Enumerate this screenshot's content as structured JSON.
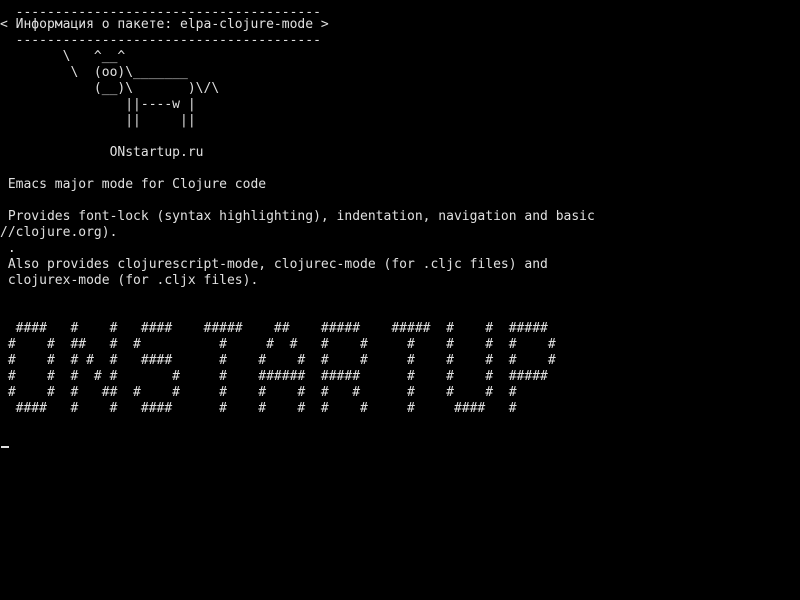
{
  "terminal": {
    "text_color": "#e0e0e0",
    "background_color": "#000000",
    "cowsay": {
      "top_border": "  ---------------------------------------",
      "message": "< Информация о пакете: elpa-clojure-mode >",
      "bottom_border": "  ---------------------------------------",
      "cow": [
        "        \\   ^__^",
        "         \\  (oo)\\_______",
        "            (__)\\       )\\/\\",
        "                ||----w |",
        "                ||     ||"
      ]
    },
    "site": "              ONstartup.ru",
    "description": {
      "summary": " Emacs major mode for Clojure code",
      "details": [
        " Provides font-lock (syntax highlighting), indentation, navigation and basic",
        "//clojure.org).",
        " .",
        " Also provides clojurescript-mode, clojurec-mode (for .cljc files) and",
        " clojurex-mode (for .cljx files)."
      ]
    },
    "banner": [
      "  ####   #    #   ####    #####    ##    #####    #####  #    #  #####",
      " #    #  ##   #  #          #     #  #   #    #     #    #    #  #    #",
      " #    #  # #  #   ####      #    #    #  #    #     #    #    #  #    #",
      " #    #  #  # #       #     #    ######  #####      #    #    #  #####",
      " #    #  #   ##  #    #     #    #    #  #   #      #    #    #  #",
      "  ####   #    #   ####      #    #    #  #    #     #     ####   #"
    ]
  }
}
